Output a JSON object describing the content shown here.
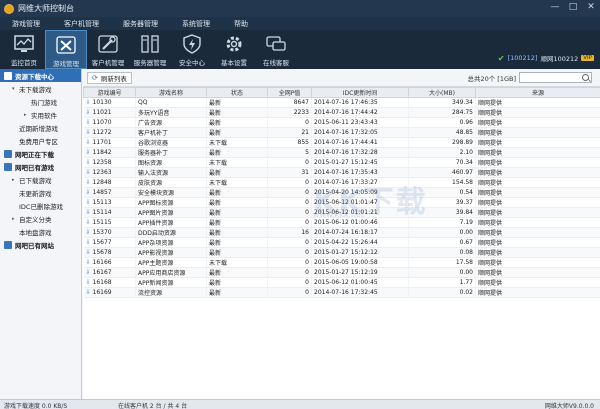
{
  "app": {
    "title": "网维大师控制台"
  },
  "window_controls": [
    "—",
    "□",
    "✕"
  ],
  "menu": [
    "游戏管理",
    "客户机管理",
    "服务器管理",
    "系统管理",
    "帮助"
  ],
  "toolbar": [
    {
      "label": "监控首页",
      "icon": "monitor-icon"
    },
    {
      "label": "游戏管理",
      "icon": "tools-icon",
      "active": true
    },
    {
      "label": "客户机管理",
      "icon": "wrench-icon"
    },
    {
      "label": "服务器管理",
      "icon": "server-icon"
    },
    {
      "label": "安全中心",
      "icon": "shield-icon"
    },
    {
      "label": "基本设置",
      "icon": "gear-icon"
    },
    {
      "label": "在线客服",
      "icon": "chat-icon"
    }
  ],
  "user": {
    "check": "✔",
    "id": "[100212]",
    "name": "顺网100212",
    "vip": "VIP"
  },
  "sidebar": [
    {
      "label": "资源下载中心",
      "level": "header",
      "active": true
    },
    {
      "label": "未下载游戏",
      "level": "l1",
      "arrow": "▾"
    },
    {
      "label": "热门游戏",
      "level": "l2"
    },
    {
      "label": "实用软件",
      "level": "l2",
      "arrow": "▸"
    },
    {
      "label": "近期新增游戏",
      "level": "l1"
    },
    {
      "label": "免费用户专区",
      "level": "l1"
    },
    {
      "label": "网吧正在下载",
      "level": "header"
    },
    {
      "label": "网吧已有游戏",
      "level": "header"
    },
    {
      "label": "已下载游戏",
      "level": "l1",
      "arrow": "▸"
    },
    {
      "label": "未更新游戏",
      "level": "l1"
    },
    {
      "label": "IDC已删除游戏",
      "level": "l1"
    },
    {
      "label": "自定义分类",
      "level": "l1",
      "arrow": "▸"
    },
    {
      "label": "本地盘游戏",
      "level": "l1"
    },
    {
      "label": "网吧已有网站",
      "level": "header"
    }
  ],
  "main": {
    "refresh_label": "刷新列表",
    "count_text": "总共20个 [1GB]",
    "columns": [
      "游戏编号",
      "游戏名称",
      "状态",
      "全网P值",
      "IDC更新时间",
      "大小(MB)",
      "来源"
    ],
    "rows": [
      [
        "10130",
        "QQ",
        "最新",
        "8647",
        "2014-07-16 17:46:35",
        "349.34",
        "顺网提供"
      ],
      [
        "11021",
        "多玩YY语音",
        "最新",
        "2233",
        "2014-07-16 17:44:42",
        "284.75",
        "顺网提供"
      ],
      [
        "11070",
        "广告资源",
        "最新",
        "0",
        "2015-06-11 23:43:43",
        "0.96",
        "顺网提供"
      ],
      [
        "11272",
        "客户机补丁",
        "最新",
        "21",
        "2014-07-16 17:32:05",
        "48.85",
        "顺网提供"
      ],
      [
        "11701",
        "谷歌浏览器",
        "未下载",
        "855",
        "2014-07-16 17:44:41",
        "298.89",
        "顺网提供"
      ],
      [
        "11842",
        "服务器补丁",
        "最新",
        "5",
        "2014-07-16 17:32:28",
        "2.10",
        "顺网提供"
      ],
      [
        "12358",
        "图标资源",
        "未下载",
        "0",
        "2015-01-27 15:12:45",
        "70.34",
        "顺网提供"
      ],
      [
        "12363",
        "输入法资源",
        "最新",
        "31",
        "2014-07-16 17:35:43",
        "460.97",
        "顺网提供"
      ],
      [
        "12848",
        "皮肤资源",
        "未下载",
        "0",
        "2014-07-16 17:33:27",
        "154.58",
        "顺网提供"
      ],
      [
        "14857",
        "安全模块资源",
        "最新",
        "0",
        "2015-04-20 14:05:09",
        "0.54",
        "顺网提供"
      ],
      [
        "15113",
        "APP图标资源",
        "最新",
        "0",
        "2015-06-12 01:01:47",
        "39.37",
        "顺网提供"
      ],
      [
        "15114",
        "APP图片资源",
        "最新",
        "0",
        "2015-06-12 01:01:21",
        "39.84",
        "顺网提供"
      ],
      [
        "15115",
        "APP插件资源",
        "最新",
        "0",
        "2015-06-12 01:00:46",
        "7.19",
        "顺网提供"
      ],
      [
        "15370",
        "DDD启动资源",
        "最新",
        "16",
        "2014-07-24 16:18:17",
        "0.00",
        "顺网提供"
      ],
      [
        "15677",
        "APP杂项资源",
        "最新",
        "0",
        "2015-04-22 15:26:44",
        "0.67",
        "顺网提供"
      ],
      [
        "15678",
        "APP影视资源",
        "最新",
        "0",
        "2015-01-27 15:12:12",
        "0.08",
        "顺网提供"
      ],
      [
        "16166",
        "APP主题资源",
        "未下载",
        "0",
        "2015-06-05 19:00:58",
        "17.58",
        "顺网提供"
      ],
      [
        "16167",
        "APP应用商店资源",
        "最新",
        "0",
        "2015-01-27 15:12:19",
        "0.00",
        "顺网提供"
      ],
      [
        "16168",
        "APP新闻资源",
        "最新",
        "0",
        "2015-06-12 01:00:45",
        "1.77",
        "顺网提供"
      ],
      [
        "16169",
        "流控资源",
        "最新",
        "0",
        "2014-07-16 17:32:45",
        "0.02",
        "顺网提供"
      ]
    ]
  },
  "watermark": {
    "main": "KK下载",
    "sub": "www.kkx.net"
  },
  "statusbar": {
    "speed": "游戏下载速度 0.0 KB/S",
    "online": "在线客户机 2 台 / 共 4 台",
    "version": "网维大师V9.0.0.0"
  }
}
